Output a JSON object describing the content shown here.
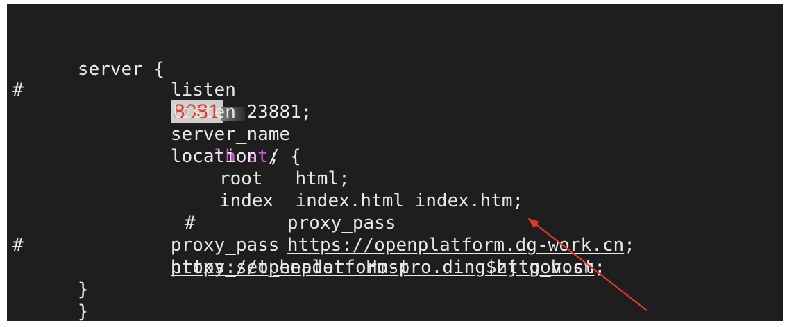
{
  "code_lines": {
    "l1": "server {",
    "l2_kw": "listen",
    "l2_value": "8081",
    "l3_hash": "#",
    "l3": "listen 23881;",
    "l4_kw": "server_name",
    "l4_value": "localhost",
    "l4_tail": ";",
    "l5": "location / {",
    "l6": "root   html;",
    "l7": "index  index.html index.htm;",
    "l8_hash": "#",
    "l8_kw": "proxy_pass",
    "l8_url": "https://openplatform.dg-work.cn",
    "l8_tail": ";",
    "l9_kw": "proxy_pass",
    "l9_url": "https://openplatform-pro.ding.zj.gov.cn",
    "l9_tail": ";",
    "l10_hash": "#",
    "l10": "proxy_set_header  Host       $http_host;",
    "l11": "}",
    "l12": "}"
  },
  "colors": {
    "background": "#1e1e1e",
    "text": "#e8e8e8",
    "highlight": "#d94fd9",
    "annotation": "#e23a2c"
  }
}
